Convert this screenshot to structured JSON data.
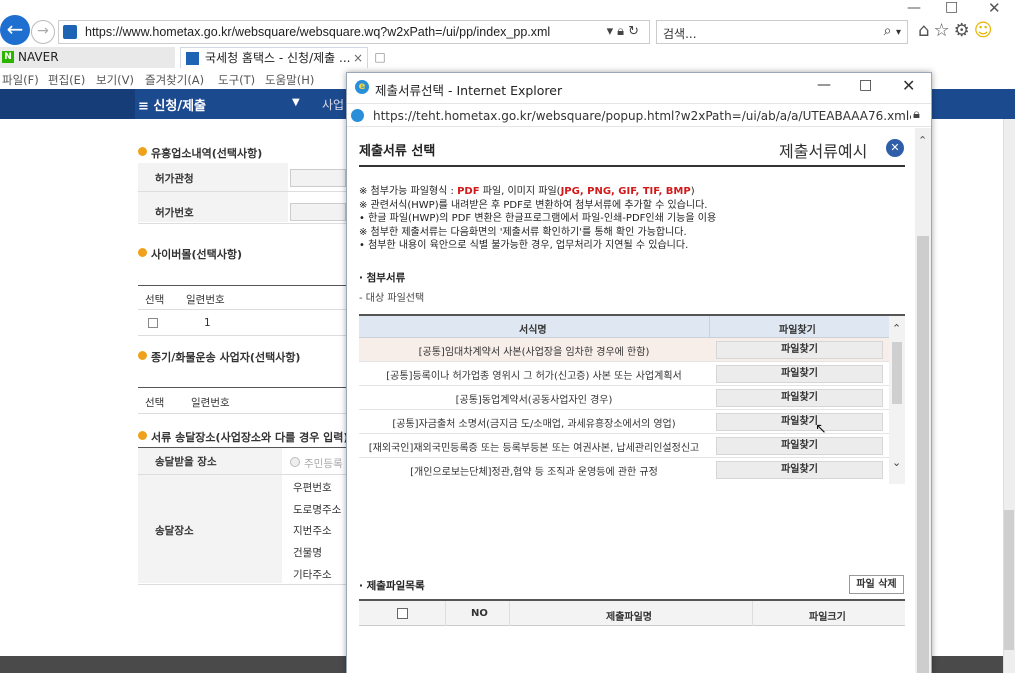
{
  "browser": {
    "url": "https://www.hometax.go.kr/websquare/websquare.wq?w2xPath=/ui/pp/index_pp.xml",
    "search_placeholder": "검색...",
    "tabs": [
      {
        "label": "NAVER"
      },
      {
        "label": "국세청 홈택스 - 신청/제출 ..."
      }
    ],
    "menu": [
      "파일(F)",
      "편집(E)",
      "보기(V)",
      "즐겨찾기(A)",
      "도구(T)",
      "도움말(H)"
    ]
  },
  "page": {
    "nav_label": "≡  신청/제출",
    "nav_sub": "사업",
    "sections": {
      "entertainment": "유흥업소내역(선택사항)",
      "license_office": "허가관청",
      "license_number": "허가번호",
      "cyber_mall": "사이버몰(선택사항)",
      "select": "선택",
      "serial": "일련번호",
      "serial_value": "1",
      "freight": "종기/화물운송 사업자(선택사항)",
      "select2": "선택",
      "serial2": "일련번호",
      "delivery": "서류 송달장소(사업장소와 다를 경우 입력)",
      "delivery_receive": "송달받을 장소",
      "resident_option": "주민등록",
      "delivery_place": "송달장소",
      "postal_code": "우편번호",
      "road_address": "도로명주소",
      "lot_address": "지번주소",
      "building": "건물명",
      "other_address": "기타주소"
    }
  },
  "popup": {
    "window_title": "제출서류선택 - Internet Explorer",
    "url": "https://teht.hometax.go.kr/websquare/popup.html?w2xPath=/ui/ab/a/a/UTEABAAA76.xml&popupID=UTI",
    "dialog_title": "제출서류 선택",
    "example_label": "제출서류예시",
    "notes": {
      "n1_prefix": "※ 첨부가능 파일형식 : ",
      "n1_pdf": "PDF",
      "n1_mid": " 파일, 이미지 파일(",
      "n1_img": "JPG, PNG, GIF, TIF, BMP",
      "n1_suffix": ")",
      "n2": "※ 관련서식(HWP)를 내려받은 후 PDF로 변환하여 첨부서류에 추가할 수 있습니다.",
      "n3": "  • 한글 파일(HWP)의 PDF 변환은 한글프로그램에서 파일-인쇄-PDF인쇄 기능을 이용",
      "n4": "※ 첨부한 제출서류는 다음화면의 '제출서류 확인하기'를 통해 확인 가능합니다.",
      "n5": "  • 첨부한 내용이 육안으로 식별 불가능한 경우, 업무처리가 지연될 수 있습니다."
    },
    "attach_title": "· 첨부서류",
    "attach_desc": "- 대상 파일선택",
    "form_table": {
      "col_name": "서식명",
      "col_file": "파일찾기",
      "rows": [
        {
          "name": "[공통]임대차계약서 사본(사업장을 임차한 경우에 한함)",
          "button": "파일찾기"
        },
        {
          "name": "[공통]등록이나 허가업종 영위시 그 허가(신고증) 사본 또는 사업계획서",
          "button": "파일찾기"
        },
        {
          "name": "[공통]동업계약서(공동사업자인 경우)",
          "button": "파일찾기"
        },
        {
          "name": "[공통]자금출처 소명서(금지금 도/소매업, 과세유흥장소에서의 영업)",
          "button": "파일찾기"
        },
        {
          "name": "[재외국인]재외국민등록증 또는 등록부등본 또는 여권사본, 납세관리인설정신고",
          "button": "파일찾기"
        },
        {
          "name": "[개인으로보는단체]정관,협약 등 조직과 운영등에 관한 규정",
          "button": "파일찾기"
        }
      ]
    },
    "submitted_title": "· 제출파일목록",
    "delete_button": "파일 삭제",
    "list_table": {
      "col_no": "NO",
      "col_name": "제출파일명",
      "col_size": "파일크기"
    }
  }
}
